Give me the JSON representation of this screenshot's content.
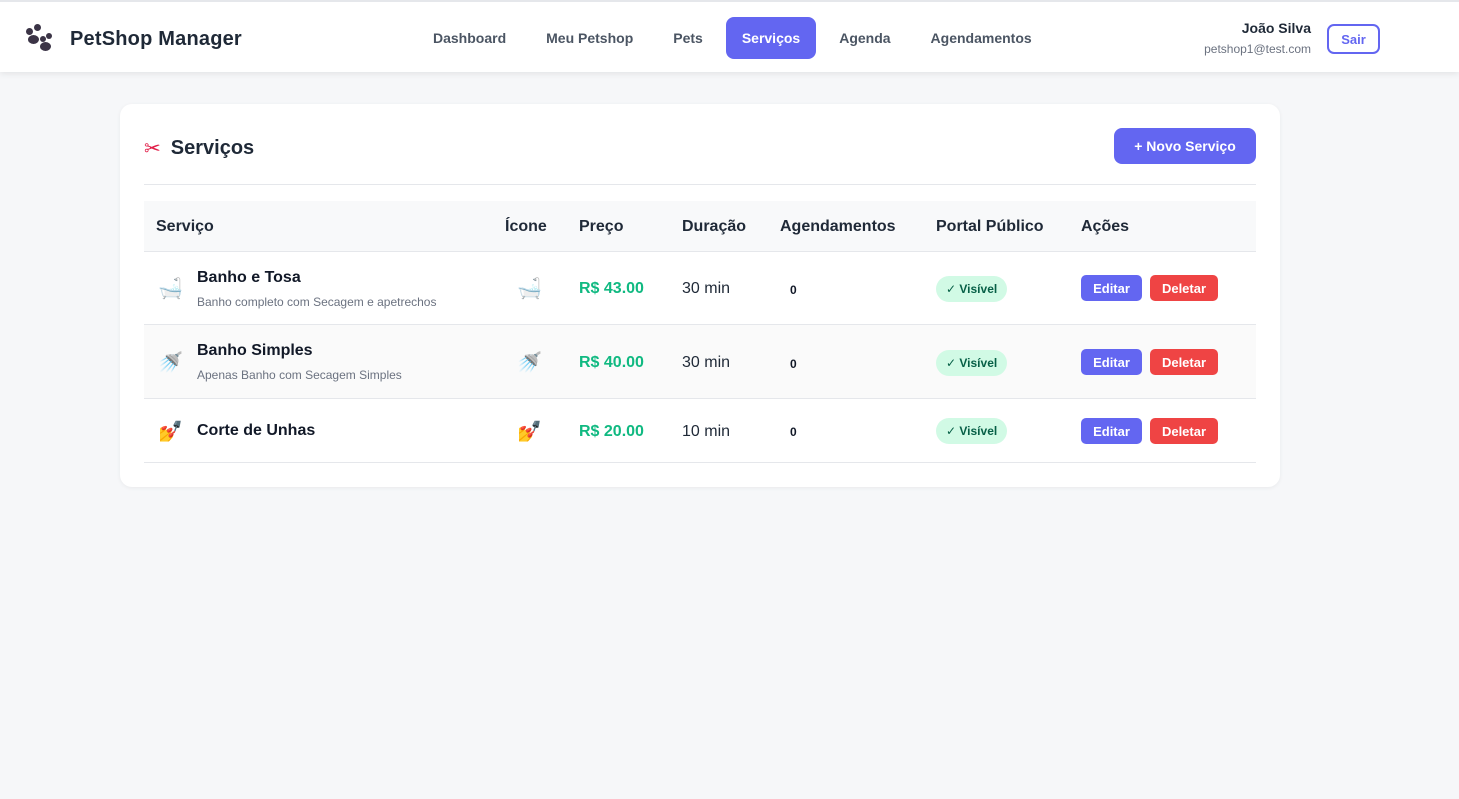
{
  "app": {
    "title": "PetShop Manager",
    "logo_icon": "paw-icon"
  },
  "nav": {
    "items": [
      {
        "label": "Dashboard",
        "active": false
      },
      {
        "label": "Meu Petshop",
        "active": false
      },
      {
        "label": "Pets",
        "active": false
      },
      {
        "label": "Serviços",
        "active": true
      },
      {
        "label": "Agenda",
        "active": false
      },
      {
        "label": "Agendamentos",
        "active": false
      }
    ]
  },
  "user": {
    "name": "João Silva",
    "email": "petshop1@test.com",
    "logout_label": "Sair"
  },
  "page": {
    "title": "Serviços",
    "title_icon": "scissors-icon",
    "title_glyph": "✂",
    "new_button": "+ Novo Serviço"
  },
  "table": {
    "headers": [
      "Serviço",
      "Ícone",
      "Preço",
      "Duração",
      "Agendamentos",
      "Portal Público",
      "Ações"
    ],
    "rows": [
      {
        "icon": "bathtub-icon",
        "glyph": "🛁",
        "name": "Banho e Tosa",
        "description": "Banho completo com Secagem e apetrechos",
        "price": "R$ 43.00",
        "duration": "30 min",
        "bookings": "0",
        "portal": "✓ Visível",
        "edit": "Editar",
        "delete": "Deletar"
      },
      {
        "icon": "shower-icon",
        "glyph": "🚿",
        "name": "Banho Simples",
        "description": "Apenas Banho com Secagem Simples",
        "price": "R$ 40.00",
        "duration": "30 min",
        "bookings": "0",
        "portal": "✓ Visível",
        "edit": "Editar",
        "delete": "Deletar"
      },
      {
        "icon": "nail-polish-icon",
        "glyph": "💅",
        "name": "Corte de Unhas",
        "description": "",
        "price": "R$ 20.00",
        "duration": "10 min",
        "bookings": "0",
        "portal": "✓ Visível",
        "edit": "Editar",
        "delete": "Deletar"
      }
    ]
  },
  "colors": {
    "accent": "#6366f1",
    "danger": "#ef4444",
    "price": "#10b981",
    "badge_bg": "#d1fae5"
  }
}
